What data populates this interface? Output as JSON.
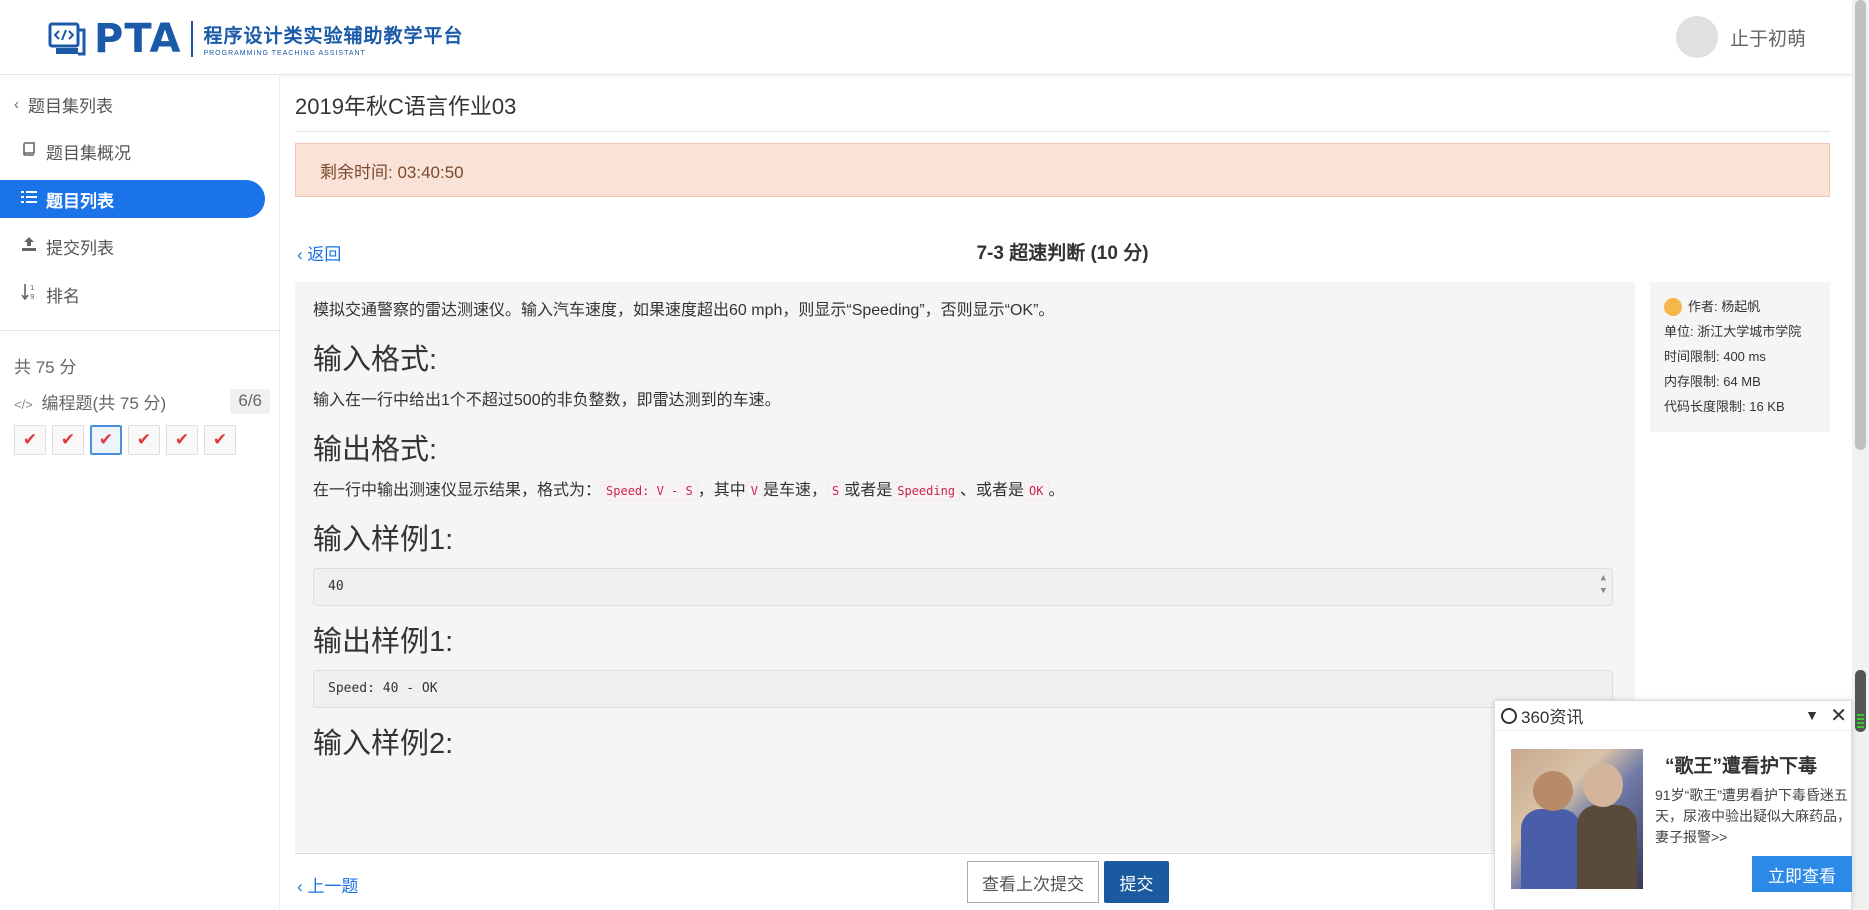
{
  "header": {
    "logo_main": "PTA",
    "logo_cn": "程序设计类实验辅助教学平台",
    "logo_en": "PROGRAMMING TEACHING ASSISTANT",
    "username": "止于初萌"
  },
  "sidebar": {
    "back_label": "题目集列表",
    "items": [
      {
        "label": "题目集概况",
        "icon": "book-icon"
      },
      {
        "label": "题目列表",
        "icon": "list-icon"
      },
      {
        "label": "提交列表",
        "icon": "upload-icon"
      },
      {
        "label": "排名",
        "icon": "sort-icon"
      }
    ],
    "total": "共 75 分",
    "category": "编程题(共 75 分)",
    "category_count": "6/6",
    "question_marks": [
      "✔",
      "✔",
      "✔",
      "✔",
      "✔",
      "✔"
    ]
  },
  "main": {
    "set_title": "2019年秋C语言作业03",
    "timer": "剩余时间: 03:40:50",
    "back": "返回",
    "problem_title": "7-3 超速判断 (10 分)",
    "description": "模拟交通警察的雷达测速仪。输入汽车速度，如果速度超出60 mph，则显示“Speeding”，否则显示“OK”。",
    "input_heading": "输入格式:",
    "input_text": "输入在一行中给出1个不超过500的非负整数，即雷达测到的车速。",
    "output_heading": "输出格式:",
    "output_text_a": "在一行中输出测速仪显示结果，格式为：",
    "output_code_1": "Speed: V - S",
    "output_text_b": "，其中",
    "output_code_2": "V",
    "output_text_c": "是车速，",
    "output_code_3": "S",
    "output_text_d": "或者是",
    "output_code_4": "Speeding",
    "output_text_e": "、或者是",
    "output_code_5": "OK",
    "output_text_f": "。",
    "sample_in_1_heading": "输入样例1:",
    "sample_in_1": "40",
    "sample_out_1_heading": "输出样例1:",
    "sample_out_1": "Speed: 40 - OK",
    "sample_in_2_heading": "输入样例2:"
  },
  "info": {
    "author": "作者: 杨起帆",
    "unit": "单位: 浙江大学城市学院",
    "time_limit": "时间限制: 400 ms",
    "mem_limit": "内存限制: 64 MB",
    "code_limit": "代码长度限制: 16 KB"
  },
  "footer": {
    "prev": "上一题",
    "view_last": "查看上次提交",
    "submit": "提交"
  },
  "ad": {
    "source": "360资讯",
    "title": "“歌王”遭看护下毒",
    "desc": "91岁“歌王”遭男看护下毒昏迷五天，尿液中验出疑似大麻药品，妻子报警>>",
    "button": "立即查看"
  },
  "colors": {
    "accent": "#1a73e8",
    "brand": "#1a5aa8",
    "timer_bg": "#fbe2d7",
    "submit_bg": "#1b5aa0",
    "check": "#e03a3a"
  }
}
